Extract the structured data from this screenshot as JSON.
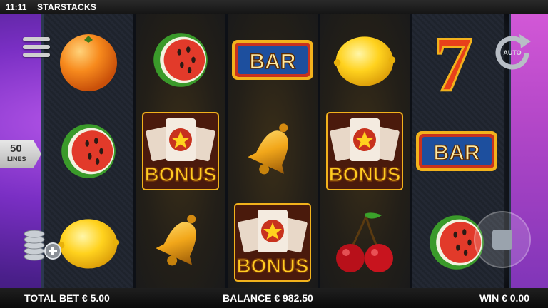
{
  "status_bar": {
    "time": "11:11",
    "title": "STARSTACKS"
  },
  "controls": {
    "lines_value": "50",
    "lines_label": "LINES",
    "auto_label": "AUTO"
  },
  "footer": {
    "total_bet": "TOTAL BET € 5.00",
    "balance": "BALANCE € 982.50",
    "win": "WIN € 0.00"
  },
  "reels": [
    [
      "orange",
      "watermelon",
      "lemon"
    ],
    [
      "watermelon",
      "bonus",
      "bell"
    ],
    [
      "bar",
      "bell",
      "bonus"
    ],
    [
      "lemon",
      "bonus",
      "cherry"
    ],
    [
      "seven",
      "bar",
      "watermelon"
    ]
  ],
  "symbol_labels": {
    "bar": "BAR",
    "bonus": "BONUS",
    "seven": "7"
  },
  "colors": {
    "accent_gold": "#f2b21c",
    "bar_blue": "#1d4f9e",
    "bonus_red": "#c8321e"
  }
}
